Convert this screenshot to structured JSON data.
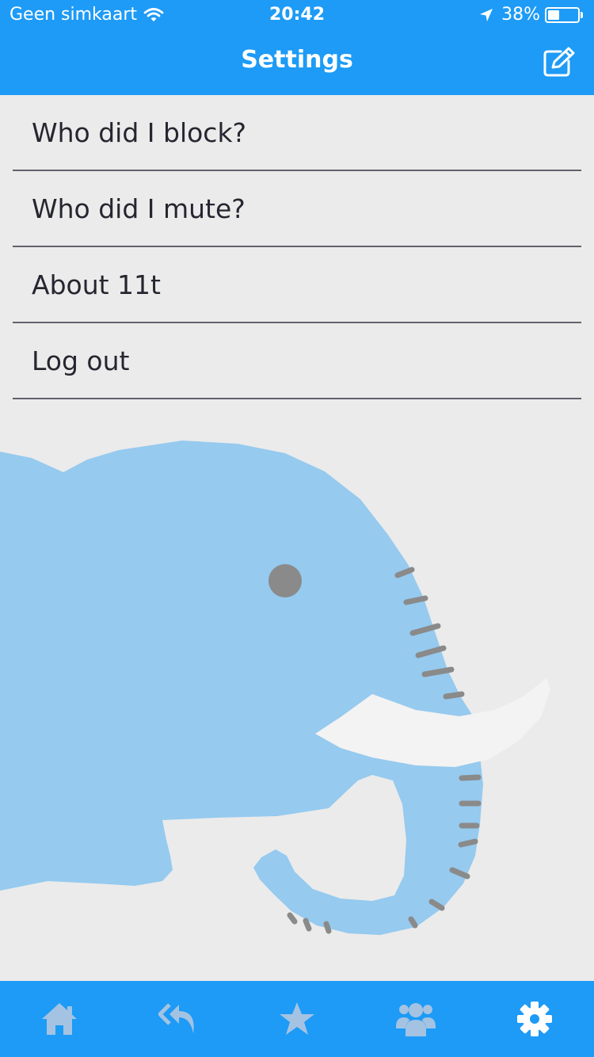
{
  "status_bar": {
    "carrier": "Geen simkaart",
    "time": "20:42",
    "battery_percent": "38%",
    "battery_level": 0.38,
    "icons": [
      "wifi-icon",
      "location-arrow-icon",
      "battery-icon"
    ]
  },
  "header": {
    "title": "Settings",
    "compose_icon": "compose-icon",
    "background_color": "#1d9bf6"
  },
  "menu": {
    "items": [
      {
        "label": "Who did I block?"
      },
      {
        "label": "Who did I mute?"
      },
      {
        "label": "About 11t"
      },
      {
        "label": "Log out"
      }
    ]
  },
  "illustration": {
    "subject": "elephant",
    "body_color": "#96caef",
    "tusk_color": "#f3f3f3",
    "eye_color": "#8a8a8a"
  },
  "tab_bar": {
    "tabs": [
      {
        "icon": "home-icon"
      },
      {
        "icon": "reply-all-icon"
      },
      {
        "icon": "star-icon"
      },
      {
        "icon": "users-icon"
      },
      {
        "icon": "gear-icon",
        "active": true
      }
    ],
    "inactive_color": "#a4c3e2",
    "active_color": "#ffffff"
  }
}
